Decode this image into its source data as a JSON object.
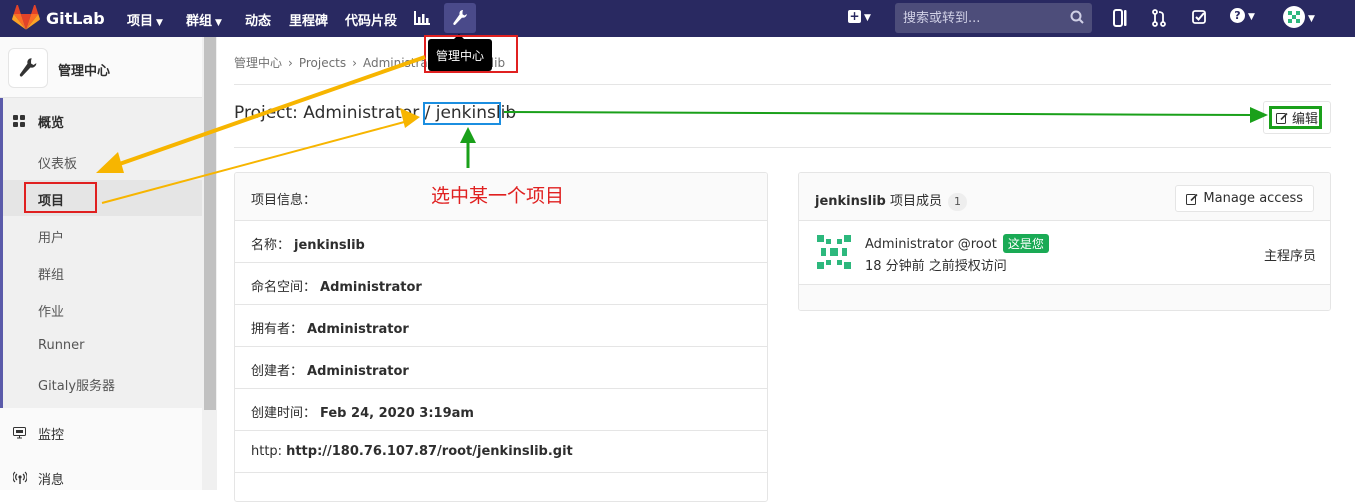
{
  "app": {
    "name": "GitLab"
  },
  "topnav": {
    "items": [
      {
        "label": "项目",
        "chevron": true
      },
      {
        "label": "群组",
        "chevron": true
      },
      {
        "label": "动态",
        "chevron": false
      },
      {
        "label": "里程碑",
        "chevron": false
      },
      {
        "label": "代码片段",
        "chevron": false
      }
    ],
    "search_placeholder": "搜索或转到..."
  },
  "tooltip": {
    "text": "管理中心"
  },
  "sidebar": {
    "title": "管理中心",
    "overview": "概览",
    "items": [
      "仪表板",
      "项目",
      "用户",
      "群组",
      "作业",
      "Runner",
      "Gitaly服务器"
    ],
    "monitoring": "监控",
    "messages": "消息"
  },
  "breadcrumb": {
    "root": "管理中心",
    "projects": "Projects",
    "namespace": "Administra",
    "project": "lib"
  },
  "project": {
    "title_prefix": "Project: Administrator / ",
    "name": "jenkinslib",
    "edit_label": "编辑"
  },
  "info": {
    "header": "项目信息：",
    "rows": [
      {
        "label": "名称：",
        "value": "jenkinslib"
      },
      {
        "label": "命名空间：",
        "value": "Administrator"
      },
      {
        "label": "拥有者：",
        "value": "Administrator"
      },
      {
        "label": "创建者：",
        "value": "Administrator"
      },
      {
        "label": "创建时间：",
        "value": "Feb 24, 2020 3:19am"
      },
      {
        "label": "http:",
        "value": "http://180.76.107.87/root/jenkinslib.git"
      }
    ]
  },
  "members": {
    "project_name": "jenkinslib",
    "title_suffix": "项目成员",
    "count": "1",
    "manage_label": "Manage access",
    "list": [
      {
        "name": "Administrator @root",
        "badge": "这是您",
        "granted": "18 分钟前 之前授权访问",
        "role": "主程序员"
      }
    ]
  },
  "annotation": {
    "text": "选中某一个项目",
    "color": "#e02020"
  },
  "colors": {
    "topbar": "#292961",
    "accent": "#1aaa55"
  }
}
